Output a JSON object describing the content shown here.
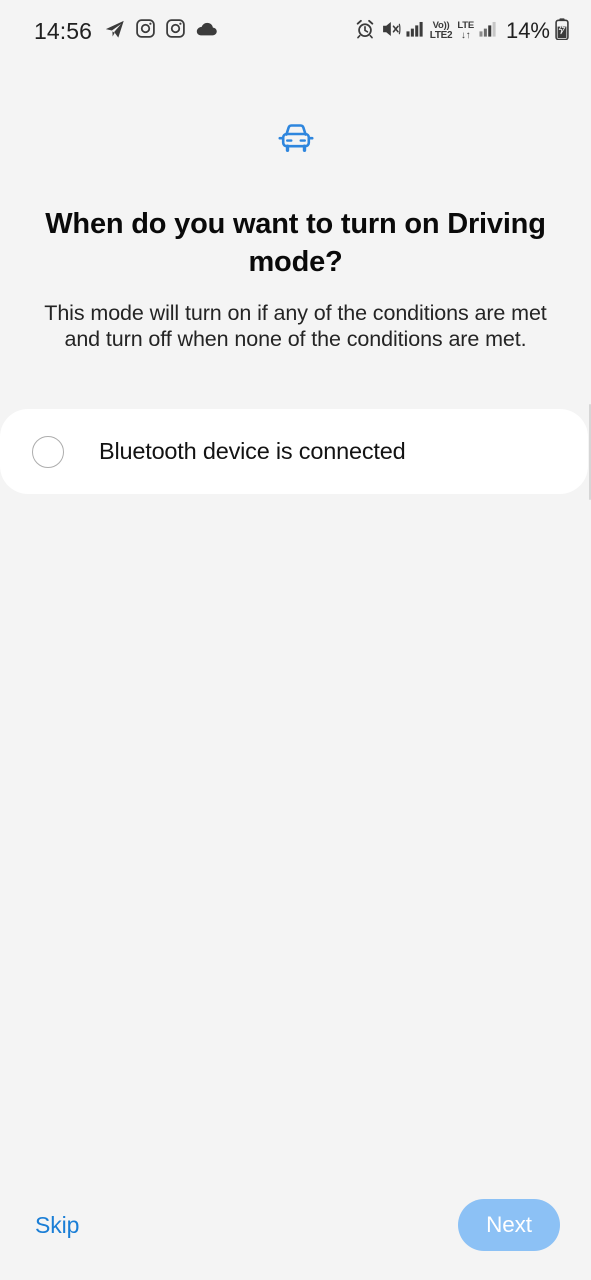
{
  "theme": {
    "background": "#f4f4f4",
    "card_background": "#ffffff",
    "accent_blue": "#1a7ed6",
    "icon_blue": "#2e86de",
    "next_button_fill": "#8cc1f5",
    "radio_border": "#adadad"
  },
  "status_bar": {
    "time": "14:56",
    "left_icons": [
      {
        "name": "telegram-icon",
        "label": "Telegram"
      },
      {
        "name": "instagram-icon",
        "label": "Instagram"
      },
      {
        "name": "instagram-icon-2",
        "label": "Instagram"
      },
      {
        "name": "cloud-icon",
        "label": "Cloud"
      }
    ],
    "right_icons": [
      {
        "name": "alarm-icon",
        "label": "Alarm"
      },
      {
        "name": "mute-vibrate-icon",
        "label": "Sound off / vibrate"
      },
      {
        "name": "signal-bars-icon",
        "label": "Signal"
      }
    ],
    "network": {
      "sim1_top": "Vo))",
      "sim1_bottom": "LTE2",
      "sim2_top": "LTE",
      "sim2_bottom": "↓↑"
    },
    "battery": {
      "percent": "14%",
      "charging": true,
      "icon": "battery-charging-icon"
    }
  },
  "header": {
    "hero_icon": "car-front-icon",
    "title": "When do you want to turn on Driving mode?",
    "subtitle": "This mode will turn on if any of the conditions are met and turn off when none of the conditions are met."
  },
  "conditions": {
    "options": [
      {
        "id": "bluetooth-device-connected",
        "label": "Bluetooth device is connected",
        "selected": false
      }
    ]
  },
  "footer": {
    "skip_label": "Skip",
    "next_label": "Next",
    "next_enabled": false
  }
}
